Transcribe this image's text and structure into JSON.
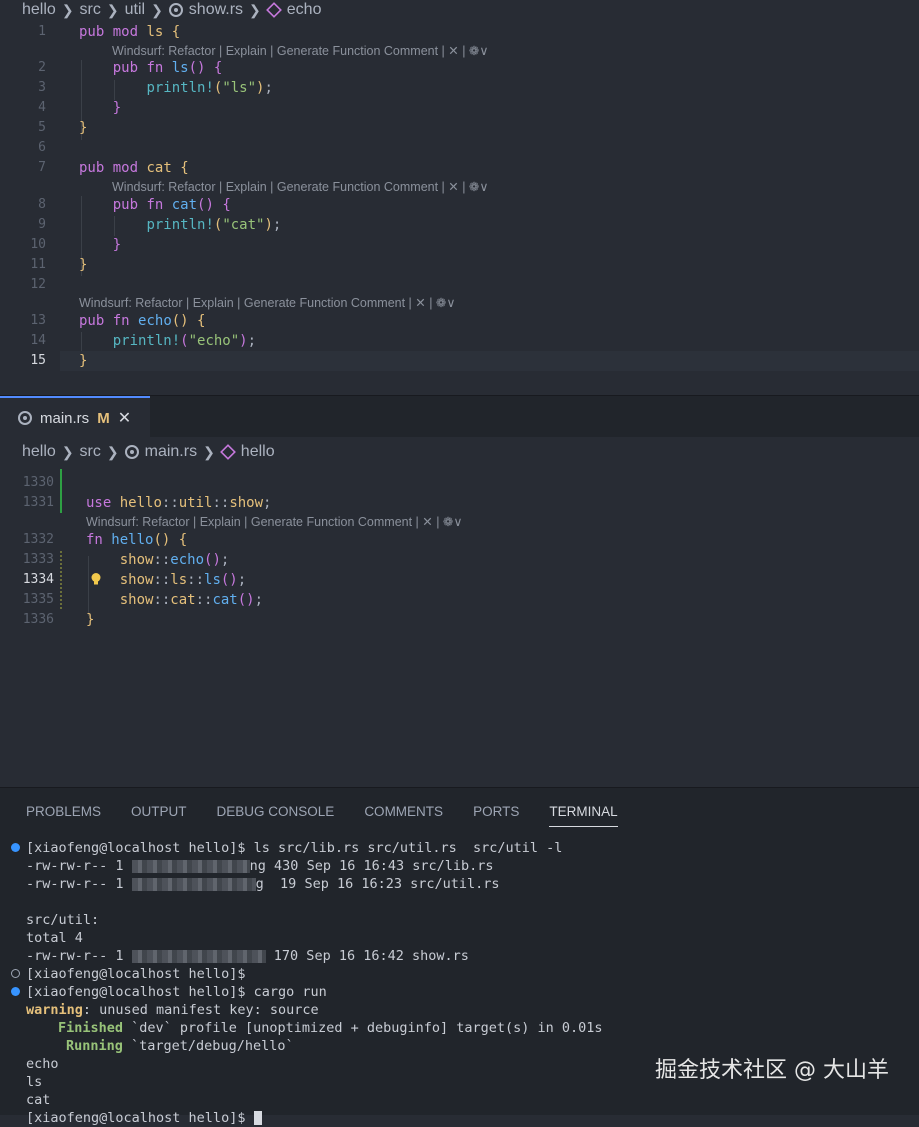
{
  "top_breadcrumb": {
    "parts": [
      "hello",
      "src",
      "util",
      "show.rs",
      "echo"
    ]
  },
  "codelens": "Windsurf: Refactor | Explain | Generate Function Comment | ✕ | ❁∨",
  "top_editor": {
    "line_numbers": [
      "1",
      "2",
      "3",
      "4",
      "5",
      "6",
      "7",
      "8",
      "9",
      "10",
      "11",
      "12",
      "13",
      "14",
      "15"
    ],
    "active_line": "15"
  },
  "tab": {
    "label": "main.rs",
    "modified": "M",
    "close": "✕"
  },
  "bottom_breadcrumb": {
    "parts": [
      "hello",
      "src",
      "main.rs",
      "hello"
    ]
  },
  "bottom_editor": {
    "line_numbers": [
      "1330",
      "1331",
      "1332",
      "1333",
      "1334",
      "1335",
      "1336"
    ],
    "active_line": "1334"
  },
  "panel": {
    "tabs": [
      "PROBLEMS",
      "OUTPUT",
      "DEBUG CONSOLE",
      "COMMENTS",
      "PORTS",
      "TERMINAL"
    ],
    "active_tab": "TERMINAL"
  },
  "terminal": {
    "prompt": "[xiaofeng@localhost hello]$",
    "cmd1": " ls src/lib.rs src/util.rs  src/util -l",
    "ls_line1_a": "-rw-rw-r-- 1 ",
    "ls_line1_b": "ng 430 Sep 16 16:43 src/lib.rs",
    "ls_line2_a": "-rw-rw-r-- 1 ",
    "ls_line2_b": "g  19 Sep 16 16:23 src/util.rs",
    "dir_header": "src/util:",
    "total": "total 4",
    "ls_line3_a": "-rw-rw-r-- 1 ",
    "ls_line3_b": " 170 Sep 16 16:42 show.rs",
    "cmd2": " cargo run",
    "warning_label": "warning",
    "warning_text": ": unused manifest key: source",
    "finished_label": "Finished",
    "finished_text": " `dev` profile [unoptimized + debuginfo] target(s) in 0.01s",
    "running_label": "Running",
    "running_text": " `target/debug/hello`",
    "out1": "echo",
    "out2": "ls",
    "out3": "cat",
    "last_prompt": "[xiaofeng@localhost hello]$ "
  },
  "watermark": "掘金技术社区 @ 大山羊",
  "colors": {
    "keyword": "#c678dd",
    "function": "#61afef",
    "string": "#98c379",
    "macro": "#56b6c2",
    "tab_accent": "#528bff",
    "modified": "#e5c07b"
  }
}
